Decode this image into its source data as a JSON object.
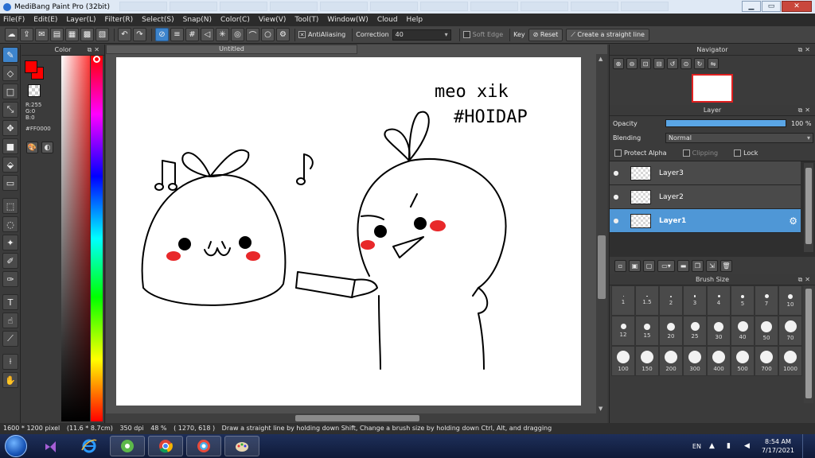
{
  "window": {
    "title": "MediBang Paint Pro (32bit)",
    "minimize": "▁",
    "maximize": "▭",
    "close": "✕"
  },
  "menu": [
    "File(F)",
    "Edit(E)",
    "Layer(L)",
    "Filter(R)",
    "Select(S)",
    "Snap(N)",
    "Color(C)",
    "View(V)",
    "Tool(T)",
    "Window(W)",
    "Cloud",
    "Help"
  ],
  "toolbar": {
    "antialiasing_label": "AntiAliasing",
    "correction_label": "Correction",
    "correction_value": "40",
    "soft_edge_label": "Soft Edge",
    "key_label": "Key",
    "reset_label": "Reset",
    "straight_line_label": "Create a straight line"
  },
  "color_panel": {
    "title": "Color",
    "rgb": [
      "R:255",
      "G:0",
      "B:0"
    ],
    "hex": "#FF0000",
    "primary_color": "#ff0000"
  },
  "document": {
    "tab": "Untitled"
  },
  "drawing_text": {
    "line1": "meo xik",
    "line2": "#HOIDAP"
  },
  "navigator": {
    "title": "Navigator"
  },
  "layer_panel": {
    "title": "Layer",
    "opacity_label": "Opacity",
    "opacity_value": "100 %",
    "opacity_fraction": 1.0,
    "blending_label": "Blending",
    "blending_value": "Normal",
    "protect_alpha": "Protect Alpha",
    "clipping": "Clipping",
    "lock": "Lock",
    "layers": [
      {
        "name": "Layer3",
        "selected": false
      },
      {
        "name": "Layer2",
        "selected": false
      },
      {
        "name": "Layer1",
        "selected": true
      }
    ]
  },
  "brush_panel": {
    "title": "Brush Size",
    "sizes": [
      "1",
      "1.5",
      "2",
      "3",
      "4",
      "5",
      "7",
      "10",
      "12",
      "15",
      "20",
      "25",
      "30",
      "40",
      "50",
      "70",
      "100",
      "150",
      "200",
      "300",
      "400",
      "500",
      "700",
      "1000"
    ]
  },
  "status": {
    "pixels": "1600 * 1200 pixel",
    "cm": "(11.6 * 8.7cm)",
    "dpi": "350 dpi",
    "zoom": "48 %",
    "coords": "( 1270, 618 )",
    "hint": "Draw a straight line by holding down Shift, Change a brush size by holding down Ctrl, Alt, and dragging"
  },
  "taskbar": {
    "lang": "EN",
    "time": "8:54 AM",
    "date": "7/17/2021"
  }
}
